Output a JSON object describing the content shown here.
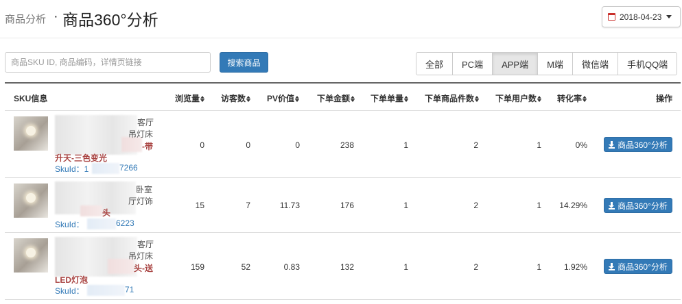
{
  "header": {
    "breadcrumb_parent": "商品分析",
    "breadcrumb_sep": "·",
    "page_title": "商品360°分析",
    "date": "2018-04-23"
  },
  "search": {
    "placeholder": "商品SKU ID, 商品编码，详情页链接",
    "button_label": "搜索商品"
  },
  "channels": {
    "tabs": [
      "全部",
      "PC端",
      "APP端",
      "M端",
      "微信端",
      "手机QQ端"
    ],
    "active": "APP端"
  },
  "table": {
    "columns": [
      "SKU信息",
      "浏览量",
      "访客数",
      "PV价值",
      "下单金额",
      "下单单量",
      "下单商品件数",
      "下单用户数",
      "转化率",
      "操作"
    ],
    "action_label": "商品360°分析",
    "rows": [
      {
        "title_lines": [
          "客厅",
          "吊灯床",
          "-带",
          "升天-三色变光"
        ],
        "sku": "SkuId：1",
        "sku_tail": "7266",
        "pv": "0",
        "uv": "0",
        "pv_value": "0",
        "amount": "238",
        "orders": "1",
        "items": "2",
        "users": "1",
        "conversion": "0%"
      },
      {
        "title_lines": [
          "卧室",
          "厅灯饰",
          "头"
        ],
        "sku": "SkuId：",
        "sku_tail": "6223",
        "pv": "15",
        "uv": "7",
        "pv_value": "11.73",
        "amount": "176",
        "orders": "1",
        "items": "2",
        "users": "1",
        "conversion": "14.29%"
      },
      {
        "title_lines": [
          "客厅",
          "吊灯床",
          "头-送",
          "LED灯泡"
        ],
        "sku": "SkuId：",
        "sku_tail": "71",
        "pv": "159",
        "uv": "52",
        "pv_value": "0.83",
        "amount": "132",
        "orders": "1",
        "items": "2",
        "users": "1",
        "conversion": "1.92%"
      }
    ]
  },
  "colors": {
    "primary": "#337ab7",
    "title_red": "#a94442"
  }
}
